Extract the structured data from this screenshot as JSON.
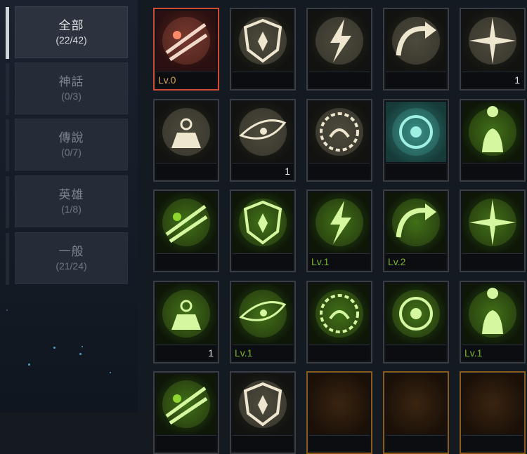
{
  "categories": [
    {
      "name": "全部",
      "count": "(22/42)",
      "selected": true
    },
    {
      "name": "神話",
      "count": "(0/3)",
      "selected": false
    },
    {
      "name": "傳說",
      "count": "(0/7)",
      "selected": false
    },
    {
      "name": "英雄",
      "count": "(1/8)",
      "selected": false
    },
    {
      "name": "一般",
      "count": "(21/24)",
      "selected": false
    }
  ],
  "cards": [
    {
      "icon": "dual-blades-slash-icon",
      "level": "Lv.0",
      "qty": "",
      "theme": "red",
      "selected": true
    },
    {
      "icon": "shield-crest-icon",
      "level": "",
      "qty": "",
      "theme": "dark"
    },
    {
      "icon": "lightning-bolt-icon",
      "level": "",
      "qty": "",
      "theme": "dark"
    },
    {
      "icon": "curved-arrow-icon",
      "level": "",
      "qty": "",
      "theme": "dark"
    },
    {
      "icon": "starburst-icon",
      "level": "",
      "qty": "1",
      "theme": "dark"
    },
    {
      "icon": "weight-sparkle-icon",
      "level": "",
      "qty": "",
      "theme": "dark"
    },
    {
      "icon": "eye-icon",
      "level": "",
      "qty": "1",
      "theme": "dark"
    },
    {
      "icon": "thorn-ring-icon",
      "level": "",
      "qty": "",
      "theme": "dark"
    },
    {
      "icon": "teal-rune-icon",
      "level": "",
      "qty": "",
      "theme": "teal"
    },
    {
      "icon": "silhouette-aura-icon",
      "level": "",
      "qty": "",
      "theme": "green"
    },
    {
      "icon": "dash-runner-icon",
      "level": "",
      "qty": "",
      "theme": "green"
    },
    {
      "icon": "star-cycle-icon",
      "level": "",
      "qty": "",
      "theme": "green"
    },
    {
      "icon": "sigil-orb-icon",
      "level": "Lv.1",
      "qty": "",
      "theme": "green"
    },
    {
      "icon": "sword-swirl-icon",
      "level": "Lv.2",
      "qty": "",
      "theme": "green"
    },
    {
      "icon": "crowd-silhouette-icon",
      "level": "",
      "qty": "",
      "theme": "green"
    },
    {
      "icon": "star-burst-orb-icon",
      "level": "",
      "qty": "1",
      "theme": "green"
    },
    {
      "icon": "armor-emblem-icon",
      "level": "Lv.1",
      "qty": "",
      "theme": "green"
    },
    {
      "icon": "ornate-sword-icon",
      "level": "",
      "qty": "",
      "theme": "green"
    },
    {
      "icon": "dagger-orb-icon",
      "level": "",
      "qty": "",
      "theme": "green"
    },
    {
      "icon": "heart-pulse-icon",
      "level": "Lv.1",
      "qty": "",
      "theme": "green"
    },
    {
      "icon": "cross-circle-icon",
      "level": "",
      "qty": "",
      "theme": "green"
    },
    {
      "icon": "scroll-icon",
      "level": "",
      "qty": "",
      "theme": "dark"
    },
    {
      "icon": "amber-blank-icon",
      "level": "",
      "qty": "",
      "theme": "amber",
      "gold": true
    },
    {
      "icon": "amber-blank-icon",
      "level": "",
      "qty": "",
      "theme": "amber",
      "gold": true
    },
    {
      "icon": "amber-blade-icon",
      "level": "",
      "qty": "",
      "theme": "amber",
      "gold": true
    }
  ]
}
